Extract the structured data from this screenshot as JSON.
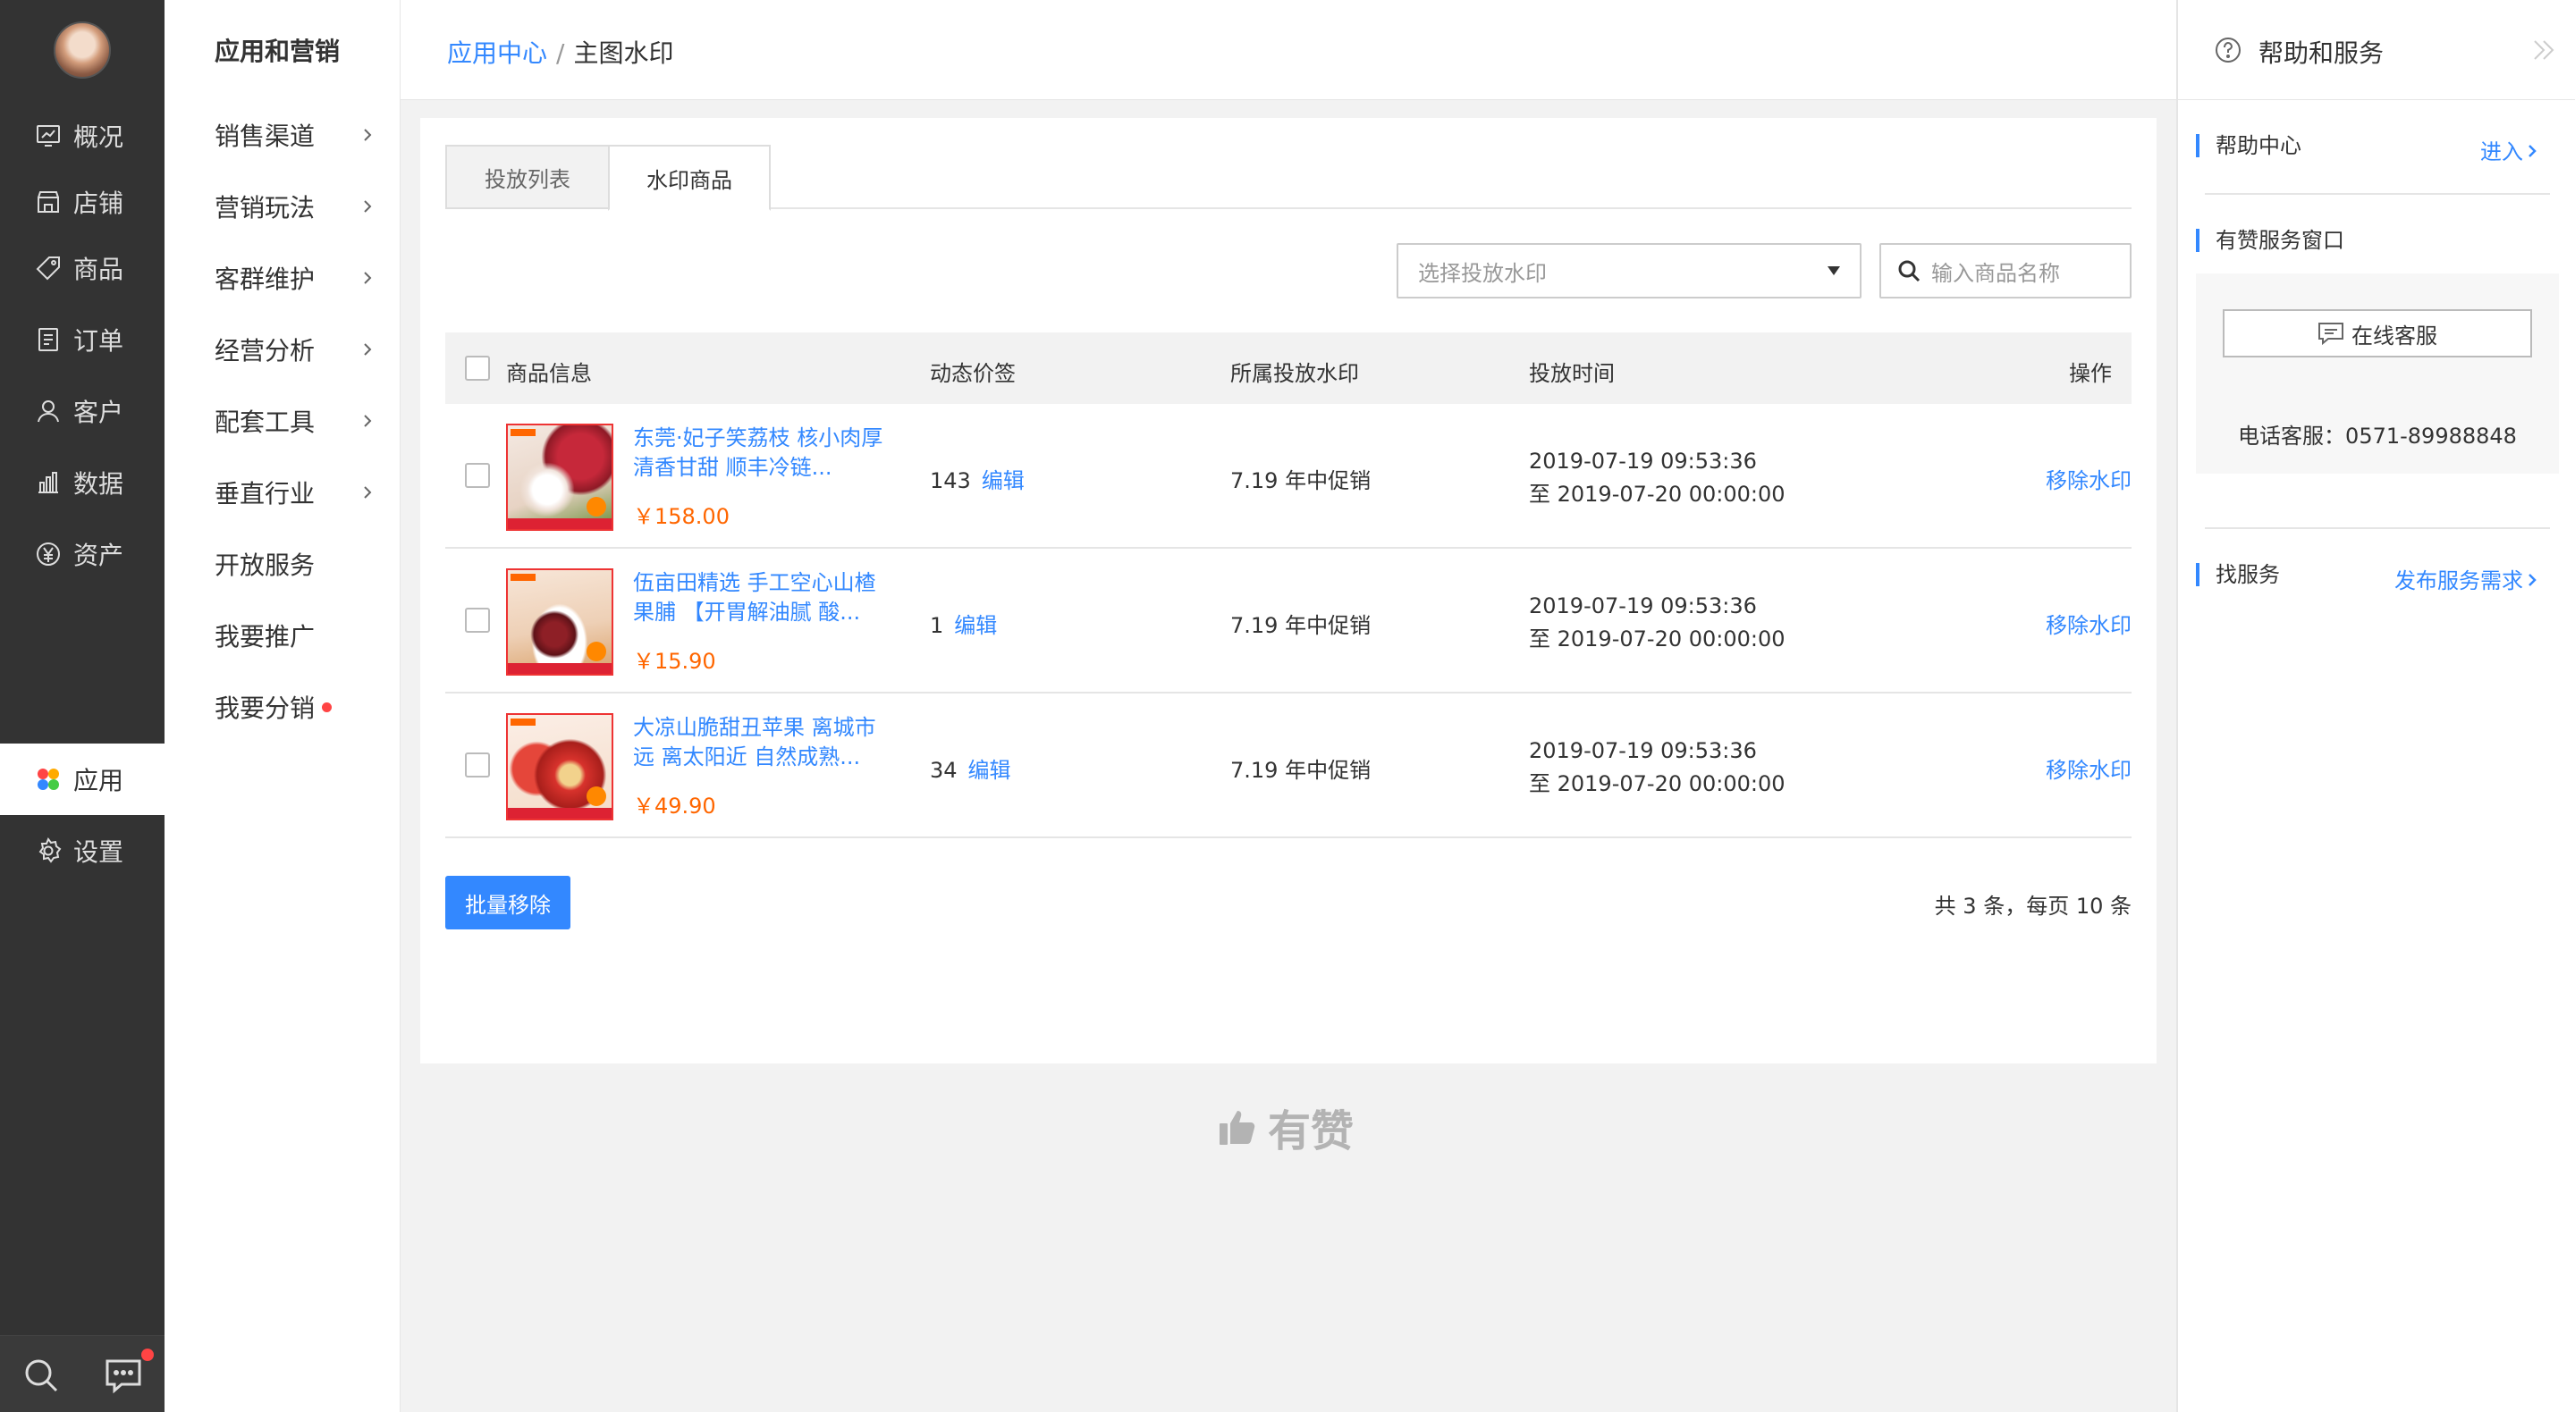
{
  "nav": {
    "items": [
      {
        "label": "概况",
        "icon": "dashboard-icon"
      },
      {
        "label": "店铺",
        "icon": "store-icon"
      },
      {
        "label": "商品",
        "icon": "tag-icon"
      },
      {
        "label": "订单",
        "icon": "order-icon"
      },
      {
        "label": "客户",
        "icon": "user-icon"
      },
      {
        "label": "数据",
        "icon": "bar-chart-icon"
      },
      {
        "label": "资产",
        "icon": "yen-icon"
      },
      {
        "label": "应用",
        "icon": "apps-icon",
        "active": true
      },
      {
        "label": "设置",
        "icon": "gear-icon"
      }
    ],
    "bottom": {
      "search_icon": "search-icon",
      "message_icon": "message-icon"
    }
  },
  "subnav": {
    "title": "应用和营销",
    "items": [
      {
        "label": "销售渠道",
        "has_chevron": true
      },
      {
        "label": "营销玩法",
        "has_chevron": true
      },
      {
        "label": "客群维护",
        "has_chevron": true
      },
      {
        "label": "经营分析",
        "has_chevron": true
      },
      {
        "label": "配套工具",
        "has_chevron": true
      },
      {
        "label": "垂直行业",
        "has_chevron": true
      },
      {
        "label": "开放服务",
        "has_chevron": false
      },
      {
        "label": "我要推广",
        "has_chevron": false
      },
      {
        "label": "我要分销",
        "has_chevron": false,
        "badge_dot": true
      }
    ]
  },
  "breadcrumb": {
    "parent": "应用中心",
    "separator": "/",
    "current": "主图水印"
  },
  "tabs": [
    {
      "label": "投放列表",
      "active": false
    },
    {
      "label": "水印商品",
      "active": true
    }
  ],
  "filters": {
    "select_placeholder": "选择投放水印",
    "search_placeholder": "输入商品名称"
  },
  "table": {
    "headers": {
      "product": "商品信息",
      "dynamic_price": "动态价签",
      "watermark": "所属投放水印",
      "time": "投放时间",
      "action": "操作"
    },
    "rows": [
      {
        "title": "东莞·妃子笑荔枝 核小肉厚 清香甘甜 顺丰冷链...",
        "price": "￥158.00",
        "dynamic_count": "143",
        "edit_label": "编辑",
        "watermark": "7.19 年中促销",
        "time_start": "2019-07-19 09:53:36",
        "time_end": "至 2019-07-20 00:00:00",
        "action": "移除水印",
        "thumb_colors": [
          "#f4e9e2",
          "#c6283a",
          "#6b8f3a"
        ]
      },
      {
        "title": "伍亩田精选 手工空心山楂果脯 【开胃解油腻 酸...",
        "price": "￥15.90",
        "dynamic_count": "1",
        "edit_label": "编辑",
        "watermark": "7.19 年中促销",
        "time_start": "2019-07-19 09:53:36",
        "time_end": "至 2019-07-20 00:00:00",
        "action": "移除水印",
        "thumb_colors": [
          "#f7e6d8",
          "#8e1f26",
          "#d9a067"
        ]
      },
      {
        "title": "大凉山脆甜丑苹果 离城市远 离太阳近 自然成熟...",
        "price": "￥49.90",
        "dynamic_count": "34",
        "edit_label": "编辑",
        "watermark": "7.19 年中促销",
        "time_start": "2019-07-19 09:53:36",
        "time_end": "至 2019-07-20 00:00:00",
        "action": "移除水印",
        "thumb_colors": [
          "#fbeee6",
          "#d8322c",
          "#f2d28c"
        ]
      }
    ]
  },
  "footer_actions": {
    "batch_remove": "批量移除",
    "total": "共 3 条，每页 10 条"
  },
  "brand": {
    "logo_text": "有赞",
    "logo_icon": "thumbs-up-icon"
  },
  "help_panel": {
    "title": "帮助和服务",
    "help_center": {
      "label": "帮助中心",
      "link": "进入"
    },
    "service_window": {
      "label": "有赞服务窗口",
      "chat_button": "在线客服",
      "phone": "电话客服：0571-89988848"
    },
    "find_service": {
      "label": "找服务",
      "link": "发布服务需求"
    }
  },
  "colors": {
    "accent": "#3388ff",
    "nav_bg": "#333333",
    "price": "#ff6600",
    "badge": "#ff4444"
  }
}
